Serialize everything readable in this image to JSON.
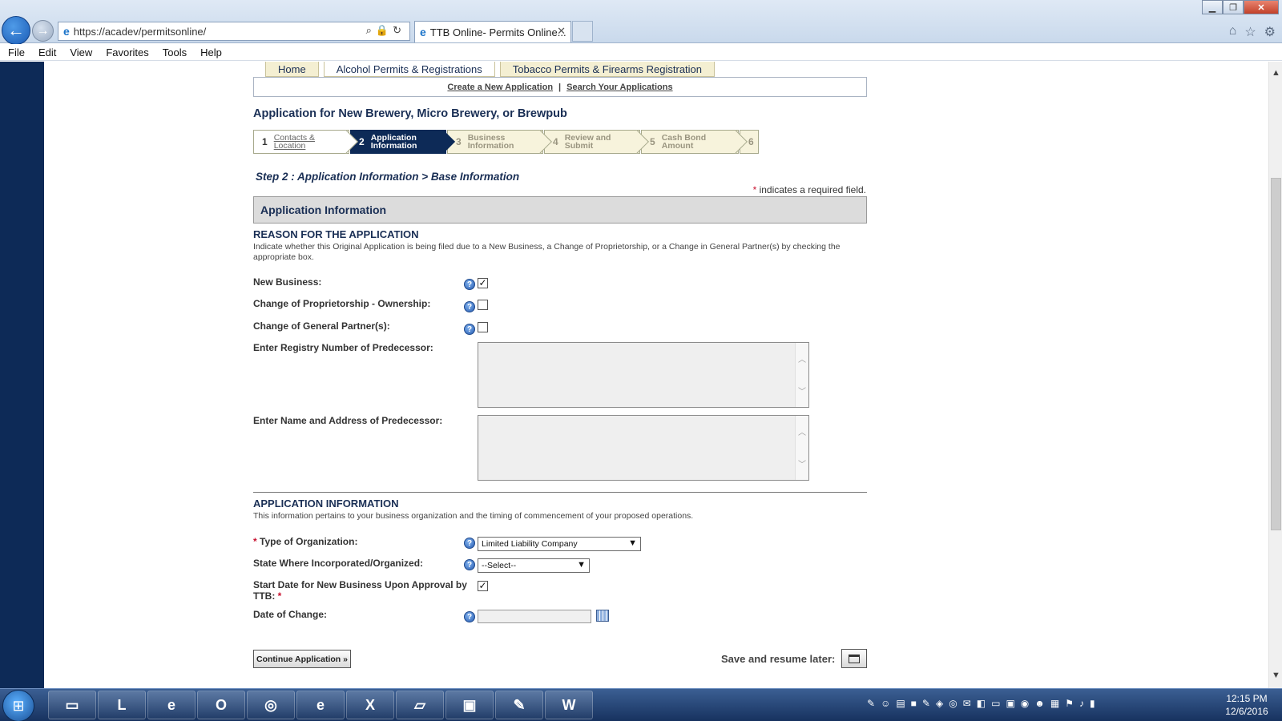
{
  "browser": {
    "url": "https://acadev/permitsonline/",
    "tab_title": "TTB Online- Permits Online...",
    "menu": [
      "File",
      "Edit",
      "View",
      "Favorites",
      "Tools",
      "Help"
    ]
  },
  "site_nav": {
    "tabs": [
      "Home",
      "Alcohol Permits & Registrations",
      "Tobacco Permits & Firearms Registration"
    ],
    "links": [
      "Create a New Application",
      "Search Your Applications"
    ],
    "separator": "|"
  },
  "page": {
    "title": "Application for New Brewery, Micro Brewery, or Brewpub",
    "steps": [
      {
        "num": "1",
        "line1": "Contacts &",
        "line2": "Location"
      },
      {
        "num": "2",
        "line1": "Application",
        "line2": "Information"
      },
      {
        "num": "3",
        "line1": "Business",
        "line2": "Information"
      },
      {
        "num": "4",
        "line1": "Review and Submit",
        "line2": ""
      },
      {
        "num": "5",
        "line1": "Cash Bond Amount",
        "line2": ""
      },
      {
        "num": "6",
        "line1": "",
        "line2": ""
      }
    ],
    "step_heading": "Step 2 : Application Information > Base Information",
    "required_star": "*",
    "required_note": "indicates a required field.",
    "section_bar": "Application Information"
  },
  "reason": {
    "title": "REASON FOR THE APPLICATION",
    "desc": "Indicate whether this Original Application is being filed due to a New Business, a Change of Proprietorship, or a Change in General Partner(s) by checking the appropriate box.",
    "new_business": "New Business:",
    "change_proprietorship": "Change of Proprietorship - Ownership:",
    "change_partners": "Change of General Partner(s):",
    "registry_number": "Enter Registry Number of Predecessor:",
    "name_address": "Enter Name and Address of Predecessor:",
    "help_glyph": "?",
    "check_glyph": "✓"
  },
  "app_info": {
    "title": "APPLICATION INFORMATION",
    "desc": "This information pertains to your business organization and the timing of commencement of your proposed operations.",
    "required_star": "*",
    "org_type_label": "Type of Organization:",
    "org_type_value": "Limited Liability Company",
    "state_label": "State Where Incorporated/Organized:",
    "state_value": "--Select--",
    "start_date_label_1": "Start Date for New Business Upon Approval by",
    "start_date_label_2": "TTB:",
    "date_change_label": "Date of Change:"
  },
  "actions": {
    "continue": "Continue Application »",
    "save_later": "Save and resume later:"
  },
  "taskbar": {
    "time": "12:15 PM",
    "date": "12/6/2016"
  }
}
